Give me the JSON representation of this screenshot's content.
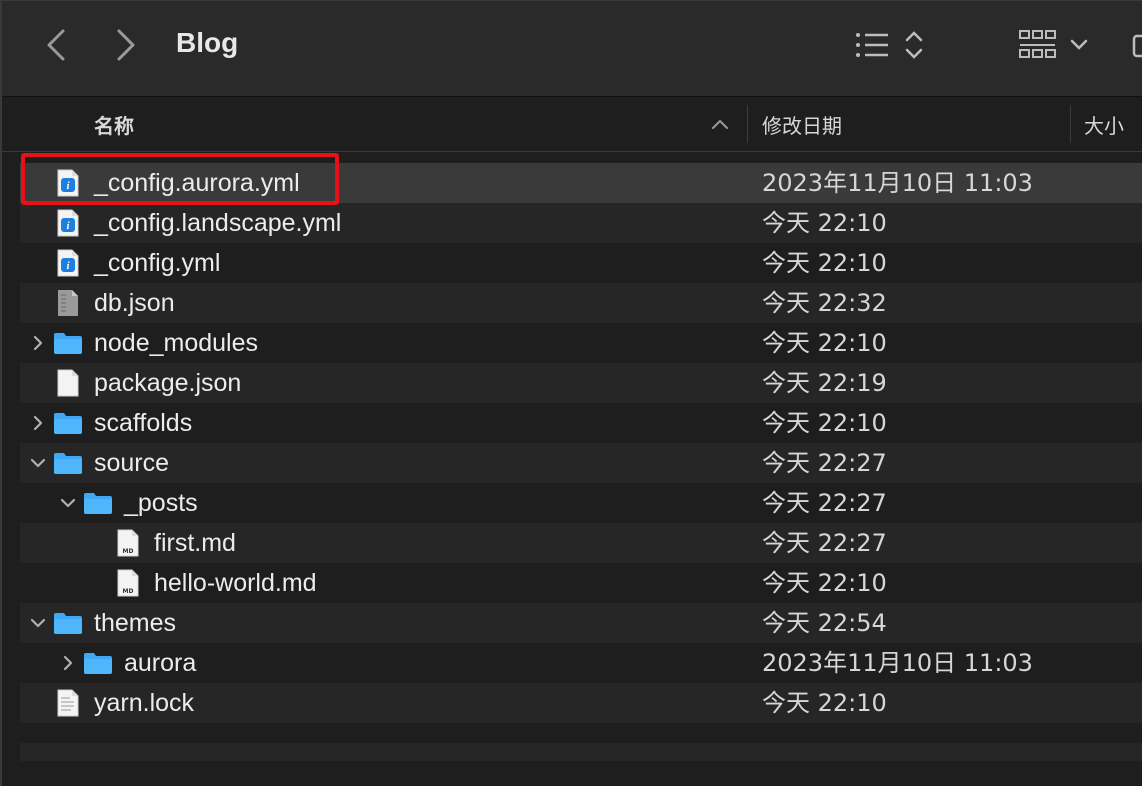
{
  "window": {
    "title": "Blog"
  },
  "columns": {
    "name": "名称",
    "date": "修改日期",
    "size": "大小"
  },
  "files": [
    {
      "name": "_config.aurora.yml",
      "date": "2023年11月10日 11:03",
      "type": "yml",
      "depth": 0,
      "disclosure": "none"
    },
    {
      "name": "_config.landscape.yml",
      "date": "今天 22:10",
      "type": "yml",
      "depth": 0,
      "disclosure": "none"
    },
    {
      "name": "_config.yml",
      "date": "今天 22:10",
      "type": "yml",
      "depth": 0,
      "disclosure": "none"
    },
    {
      "name": "db.json",
      "date": "今天 22:32",
      "type": "json-db",
      "depth": 0,
      "disclosure": "none"
    },
    {
      "name": "node_modules",
      "date": "今天 22:10",
      "type": "folder",
      "depth": 0,
      "disclosure": "collapsed"
    },
    {
      "name": "package.json",
      "date": "今天 22:19",
      "type": "doc",
      "depth": 0,
      "disclosure": "none"
    },
    {
      "name": "scaffolds",
      "date": "今天 22:10",
      "type": "folder",
      "depth": 0,
      "disclosure": "collapsed"
    },
    {
      "name": "source",
      "date": "今天 22:27",
      "type": "folder",
      "depth": 0,
      "disclosure": "expanded"
    },
    {
      "name": "_posts",
      "date": "今天 22:27",
      "type": "folder",
      "depth": 1,
      "disclosure": "expanded"
    },
    {
      "name": "first.md",
      "date": "今天 22:27",
      "type": "md",
      "depth": 2,
      "disclosure": "none"
    },
    {
      "name": "hello-world.md",
      "date": "今天 22:10",
      "type": "md",
      "depth": 2,
      "disclosure": "none"
    },
    {
      "name": "themes",
      "date": "今天 22:54",
      "type": "folder",
      "depth": 0,
      "disclosure": "expanded"
    },
    {
      "name": "aurora",
      "date": "2023年11月10日 11:03",
      "type": "folder",
      "depth": 1,
      "disclosure": "collapsed"
    },
    {
      "name": "yarn.lock",
      "date": "今天 22:10",
      "type": "text",
      "depth": 0,
      "disclosure": "none"
    }
  ],
  "selected_index": 0,
  "colors": {
    "folder": "#3fa9f5",
    "highlight": "#e8111a",
    "yml_icon": "#1d7fe0"
  }
}
